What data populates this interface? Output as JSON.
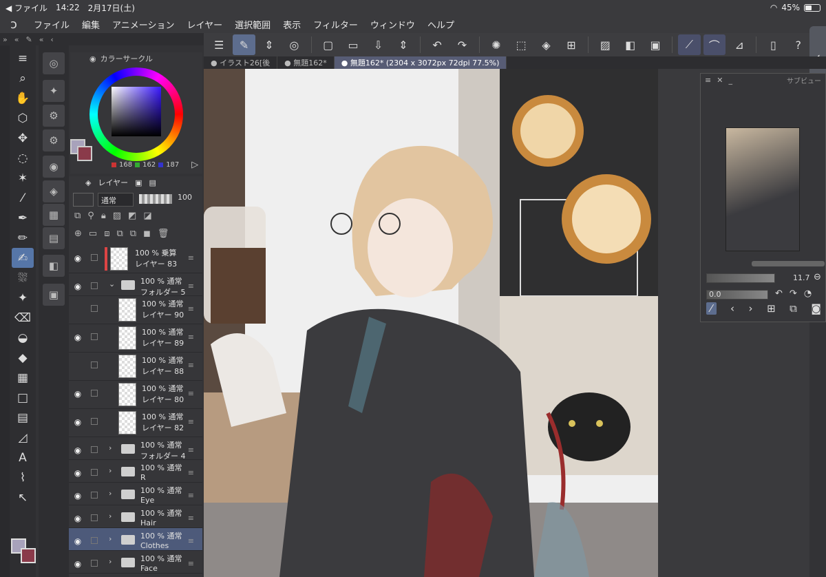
{
  "status": {
    "back_app": "◀ ファイル",
    "time": "14:22",
    "date": "2月17日(土)",
    "battery": "45%",
    "battery_level": 0.45
  },
  "menu": {
    "items": [
      "ファイル",
      "編集",
      "アニメーション",
      "レイヤー",
      "選択範囲",
      "表示",
      "フィルター",
      "ウィンドウ",
      "ヘルプ"
    ]
  },
  "tabs": [
    {
      "label": "● イラスト26[後"
    },
    {
      "label": "● 無題162*"
    },
    {
      "label": "● 無題162* (2304 x 3072px 72dpi 77.5%)"
    }
  ],
  "color_panel": {
    "title": "カラーサークル",
    "r": "168",
    "g": "162",
    "b": "187",
    "current_color": "#a8a2bb",
    "sub_color": "#8a3a4a"
  },
  "layer_panel": {
    "tab": "レイヤー",
    "blend_mode": "通常",
    "opacity": "100",
    "layers": [
      {
        "l1": "100 % 乗算",
        "l2": "レイヤー 83",
        "kind": "layer"
      },
      {
        "l1": "100 % 通常",
        "l2": "フォルダー 5",
        "kind": "folder-open"
      },
      {
        "l1": "100 % 通常",
        "l2": "レイヤー 90",
        "kind": "child"
      },
      {
        "l1": "100 % 通常",
        "l2": "レイヤー 89",
        "kind": "child"
      },
      {
        "l1": "100 % 通常",
        "l2": "レイヤー 88",
        "kind": "child"
      },
      {
        "l1": "100 % 通常",
        "l2": "レイヤー 80",
        "kind": "child"
      },
      {
        "l1": "100 % 通常",
        "l2": "レイヤー 82",
        "kind": "child"
      },
      {
        "l1": "100 % 通常",
        "l2": "フォルダー 4",
        "kind": "folder"
      },
      {
        "l1": "100 % 通常",
        "l2": "R",
        "kind": "folder"
      },
      {
        "l1": "100 % 通常",
        "l2": "Eye",
        "kind": "folder"
      },
      {
        "l1": "100 % 通常",
        "l2": "Hair",
        "kind": "folder"
      },
      {
        "l1": "100 % 通常",
        "l2": "Clothes",
        "kind": "folder"
      },
      {
        "l1": "100 % 通常",
        "l2": "Face",
        "kind": "folder"
      }
    ]
  },
  "navigator": {
    "title": "サブビュー",
    "zoom": "11.7",
    "rotate": "0.0"
  }
}
